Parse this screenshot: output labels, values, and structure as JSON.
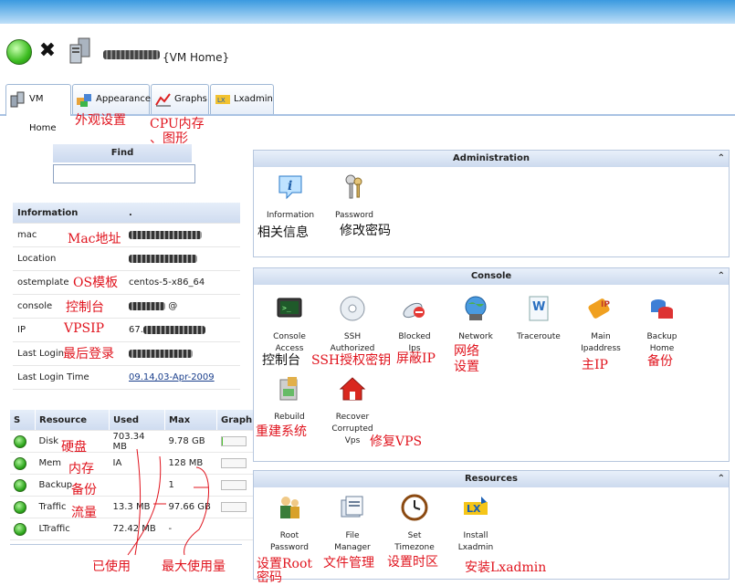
{
  "header": {
    "vm_suffix": "{VM Home}"
  },
  "tabs": [
    {
      "label": "VM Home",
      "active": true
    },
    {
      "label": "Appearance",
      "active": false
    },
    {
      "label": "Graphs",
      "active": false
    },
    {
      "label": "Lxadmin",
      "active": false
    }
  ],
  "find": {
    "label": "Find",
    "value": ""
  },
  "information": {
    "header": [
      "Information",
      "."
    ],
    "rows": [
      {
        "key": "mac",
        "value": ""
      },
      {
        "key": "Location",
        "value": ""
      },
      {
        "key": "ostemplate",
        "value": "centos-5-x86_64"
      },
      {
        "key": "console",
        "value": "@"
      },
      {
        "key": "IP",
        "value": "67."
      },
      {
        "key": "Last Login",
        "value": ""
      },
      {
        "key": "Last Login Time",
        "value": "09.14,03-Apr-2009"
      }
    ]
  },
  "resources_table": {
    "columns": [
      "S",
      "Resource",
      "Used",
      "Max",
      "Graph"
    ],
    "rows": [
      {
        "resource": "Disk",
        "used": "703.34 MB",
        "max": "9.78 GB",
        "usage": 0.07
      },
      {
        "resource": "Mem",
        "used": "IA",
        "max": "128 MB",
        "usage": 0
      },
      {
        "resource": "Backup",
        "used": "",
        "max": "1",
        "usage": 0
      },
      {
        "resource": "Traffic",
        "used": "13.3 MB",
        "max": "97.66 GB",
        "usage": 0
      },
      {
        "resource": "LTraffic",
        "used": "72.42 MB",
        "max": "-",
        "usage": null
      }
    ]
  },
  "administration": {
    "title": "Administration",
    "items": [
      {
        "label": "Information",
        "icon": "information-icon"
      },
      {
        "label": "Password",
        "icon": "keys-icon"
      }
    ]
  },
  "console": {
    "title": "Console",
    "items": [
      {
        "label": "Console\nAccess",
        "icon": "terminal-icon"
      },
      {
        "label": "SSH\nAuthorized",
        "icon": "cd-icon"
      },
      {
        "label": "Blocked\nIps",
        "icon": "blocked-icon"
      },
      {
        "label": "Network",
        "icon": "network-icon"
      },
      {
        "label": "Traceroute",
        "icon": "traceroute-icon"
      },
      {
        "label": "Main\nIpaddress",
        "icon": "ip-icon"
      },
      {
        "label": "Backup\nHome",
        "icon": "backup-icon"
      },
      {
        "label": "Rebuild",
        "icon": "rebuild-icon"
      },
      {
        "label": "Recover\nCorrupted\nVps",
        "icon": "recover-icon"
      }
    ]
  },
  "resources_panel": {
    "title": "Resources",
    "items": [
      {
        "label": "Root\nPassword",
        "icon": "root-icon"
      },
      {
        "label": "File\nManager",
        "icon": "file-manager-icon"
      },
      {
        "label": "Set\nTimezone",
        "icon": "clock-icon"
      },
      {
        "label": "Install\nLxadmin",
        "icon": "lxadmin-icon"
      }
    ]
  },
  "annotations": {
    "appearance": "外观设置",
    "graphs_line1": "CPU内存",
    "graphs_line2": "、图形",
    "mac": "Mac地址",
    "ostemplate": "OS模板",
    "console": "控制台",
    "ip": "VPSIP",
    "last_login": "最后登录",
    "disk": "硬盘",
    "mem": "内存",
    "backup": "备份",
    "traffic": "流量",
    "used": "已使用",
    "max": "最大使用量",
    "info": "相关信息",
    "password": "修改密码",
    "console_access": "控制台",
    "ssh": "SSH授权密钥",
    "blocked": "屏蔽IP",
    "network_line1": "网络",
    "network_line2": "设置",
    "main_ip": "主IP",
    "backup_home": "备份",
    "rebuild": "重建系统",
    "recover": "修复VPS",
    "root_line1": "设置Root",
    "root_line2": "密码",
    "file_manager": "文件管理",
    "timezone": "设置时区",
    "install": "安装Lxadmin"
  },
  "colors": {
    "annotation": "#e0141e",
    "header_grad": "#cfdcf0",
    "ok": "#2ba51a"
  }
}
